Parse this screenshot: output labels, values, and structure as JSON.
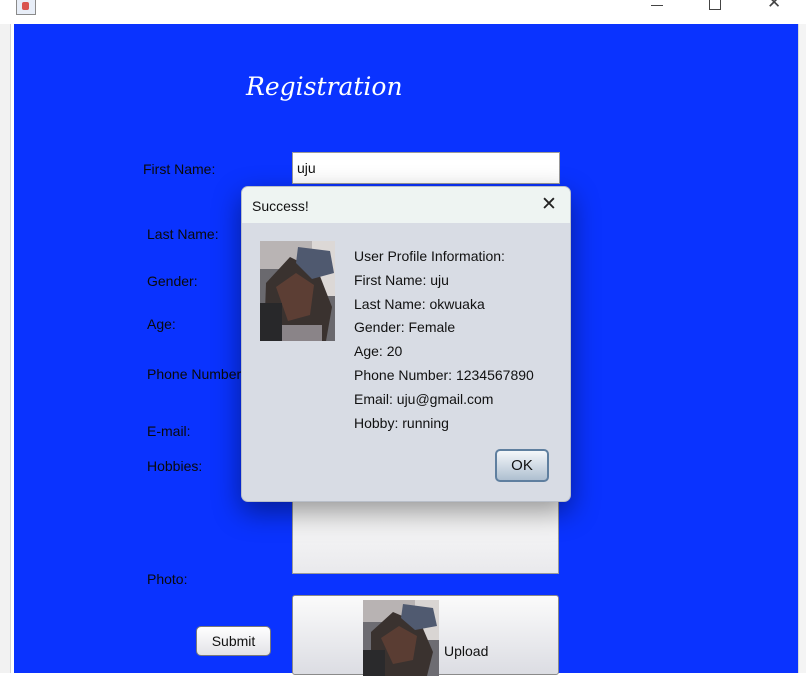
{
  "window": {
    "controls": {
      "minimize": "minimize",
      "maximize": "maximize",
      "close": "close"
    }
  },
  "form": {
    "heading": "Registration",
    "labels": {
      "first_name": "First Name:",
      "last_name": "Last Name:",
      "gender": "Gender:",
      "age": "Age:",
      "phone": "Phone Number:",
      "email": "E-mail:",
      "hobbies": "Hobbies:",
      "photo": "Photo:"
    },
    "first_name_value": "uju",
    "submit_label": "Submit",
    "upload_label": "Upload"
  },
  "dialog": {
    "title": "Success!",
    "close_glyph": "✕",
    "lines": [
      "User Profile Information:",
      "First Name: uju",
      "Last Name: okwuaka",
      "Gender: Female",
      "Age: 20",
      "Phone Number: 1234567890",
      "Email: uju@gmail.com",
      "Hobby: running"
    ],
    "ok_label": "OK"
  },
  "colors": {
    "form_background": "#0a33ff",
    "dialog_background": "#d8dce4"
  }
}
